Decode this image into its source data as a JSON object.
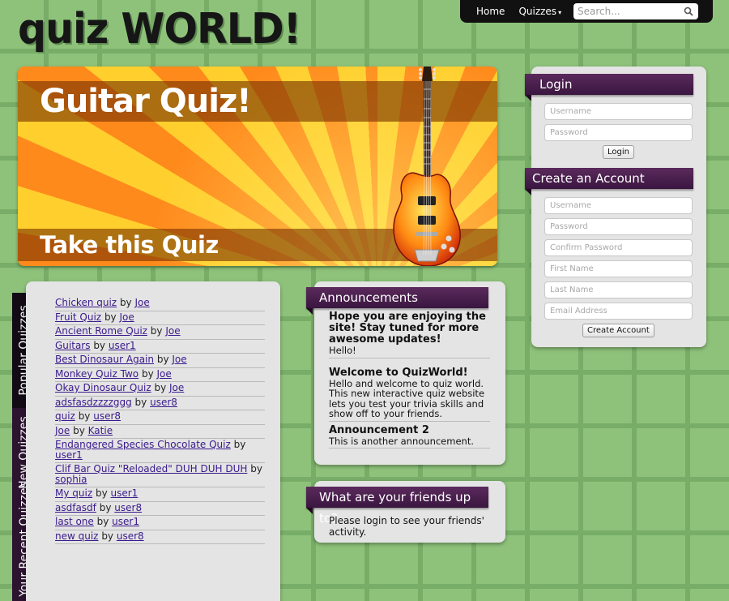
{
  "topbar": {
    "home_label": "Home",
    "quizzes_label": "Quizzes",
    "search_placeholder": "Search..."
  },
  "logo": {
    "text": "quiz WORLD!"
  },
  "hero": {
    "title": "Guitar Quiz!",
    "cta": "Take this Quiz"
  },
  "sidebar_tabs": [
    "Popular Quizzes",
    "New Quizzes",
    "Your Recent Quizzes"
  ],
  "quiz_list": [
    {
      "title": "Chicken quiz",
      "by": "by",
      "author": "Joe"
    },
    {
      "title": "Fruit Quiz",
      "by": "by",
      "author": "Joe"
    },
    {
      "title": "Ancient Rome Quiz",
      "by": "by",
      "author": "Joe"
    },
    {
      "title": "Guitars",
      "by": "by",
      "author": "user1"
    },
    {
      "title": "Best Dinosaur Again",
      "by": "by",
      "author": "Joe"
    },
    {
      "title": "Monkey Quiz Two",
      "by": "by",
      "author": "Joe"
    },
    {
      "title": "Okay Dinosaur Quiz",
      "by": "by",
      "author": "Joe"
    },
    {
      "title": "adsfasdzzzzggg",
      "by": "by",
      "author": "user8"
    },
    {
      "title": "quiz",
      "by": "by",
      "author": "user8"
    },
    {
      "title": "Joe",
      "by": "by",
      "author": "Katie"
    },
    {
      "title": "Endangered Species Chocolate Quiz",
      "by": "by",
      "author": "user1"
    },
    {
      "title": "Clif Bar Quiz \"Reloaded\" DUH DUH DUH",
      "by": "by",
      "author": "sophia"
    },
    {
      "title": "My quiz",
      "by": "by",
      "author": "user1"
    },
    {
      "title": "asdfasdf",
      "by": "by",
      "author": "user8"
    },
    {
      "title": "last one",
      "by": "by",
      "author": "user1"
    },
    {
      "title": "new quiz",
      "by": "by",
      "author": "user8"
    }
  ],
  "announcements": {
    "heading": "Announcements",
    "items": [
      {
        "title": "Hope you are enjoying the site! Stay tuned for more awesome updates!",
        "body": "Hello!"
      },
      {
        "title": "Welcome to QuizWorld!",
        "body": "Hello and welcome to quiz world. This new interactive quiz website lets you test your trivia skills and show off to your friends."
      },
      {
        "title": "Announcement 2",
        "body": "This is another announcement."
      }
    ]
  },
  "friends": {
    "heading": "What are your friends up to?",
    "text": "Please login to see your friends' activity."
  },
  "login": {
    "heading": "Login",
    "username_placeholder": "Username",
    "password_placeholder": "Password",
    "button": "Login"
  },
  "create_account": {
    "heading": "Create an Account",
    "username_placeholder": "Username",
    "password_placeholder": "Password",
    "confirm_placeholder": "Confirm Password",
    "first_name_placeholder": "First Name",
    "last_name_placeholder": "Last Name",
    "email_placeholder": "Email Address",
    "button": "Create Account"
  }
}
